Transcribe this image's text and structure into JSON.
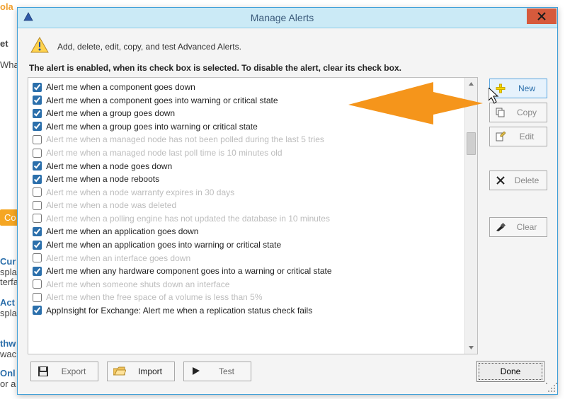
{
  "titlebar": {
    "title": "Manage Alerts"
  },
  "header": {
    "desc": "Add, delete, edit, copy, and test Advanced Alerts.",
    "bold": "The alert is enabled, when its check box is selected. To disable the alert, clear its check box."
  },
  "alerts": [
    {
      "label": "Alert me when a component goes down",
      "checked": true,
      "enabled": true
    },
    {
      "label": "Alert me when a component goes into warning or critical state",
      "checked": true,
      "enabled": true
    },
    {
      "label": "Alert me when a group goes down",
      "checked": true,
      "enabled": true
    },
    {
      "label": "Alert me when a group goes into warning or critical state",
      "checked": true,
      "enabled": true
    },
    {
      "label": "Alert me when a managed node has not been polled during the last 5 tries",
      "checked": false,
      "enabled": false
    },
    {
      "label": "Alert me when a managed node last poll time is 10 minutes old",
      "checked": false,
      "enabled": false
    },
    {
      "label": "Alert me when a node goes down",
      "checked": true,
      "enabled": true
    },
    {
      "label": "Alert me when a node reboots",
      "checked": true,
      "enabled": true
    },
    {
      "label": "Alert me when a node warranty expires in 30 days",
      "checked": false,
      "enabled": false
    },
    {
      "label": "Alert me when a node was deleted",
      "checked": false,
      "enabled": false
    },
    {
      "label": "Alert me when a polling engine has not updated the database in 10 minutes",
      "checked": false,
      "enabled": false
    },
    {
      "label": "Alert me when an application goes down",
      "checked": true,
      "enabled": true
    },
    {
      "label": "Alert me when an application goes into warning or critical state",
      "checked": true,
      "enabled": true
    },
    {
      "label": "Alert me when an interface goes down",
      "checked": false,
      "enabled": false
    },
    {
      "label": "Alert me when any hardware component goes into a warning or critical state",
      "checked": true,
      "enabled": true
    },
    {
      "label": "Alert me when someone shuts down an interface",
      "checked": false,
      "enabled": false
    },
    {
      "label": "Alert me when the free space of a volume is less than 5%",
      "checked": false,
      "enabled": false
    },
    {
      "label": "AppInsight for Exchange: Alert me when a replication status check fails",
      "checked": true,
      "enabled": true
    }
  ],
  "side": {
    "new": "New",
    "copy": "Copy",
    "edit": "Edit",
    "delete": "Delete",
    "clear": "Clear"
  },
  "footer": {
    "export": "Export",
    "import": "Import",
    "test": "Test",
    "done": "Done"
  },
  "icons": {
    "close": "X",
    "plus": "plus-icon",
    "copy": "copy-icon",
    "edit": "edit-icon",
    "delete": "delete-icon",
    "clear": "clear-icon",
    "save": "save-icon",
    "open": "open-icon",
    "flag": "flag-icon",
    "warn": "warning-icon"
  },
  "bg": {
    "f1": "ola",
    "f2": "et",
    "f3": "Wha",
    "co": "Co",
    "cur": "Cur",
    "spla": "spla",
    "terfa": "terfa",
    "act": "Act",
    "spla2": "spla",
    "thw": "thw",
    "wac": "wac",
    "onl": "Onl",
    "ora": "or a"
  }
}
